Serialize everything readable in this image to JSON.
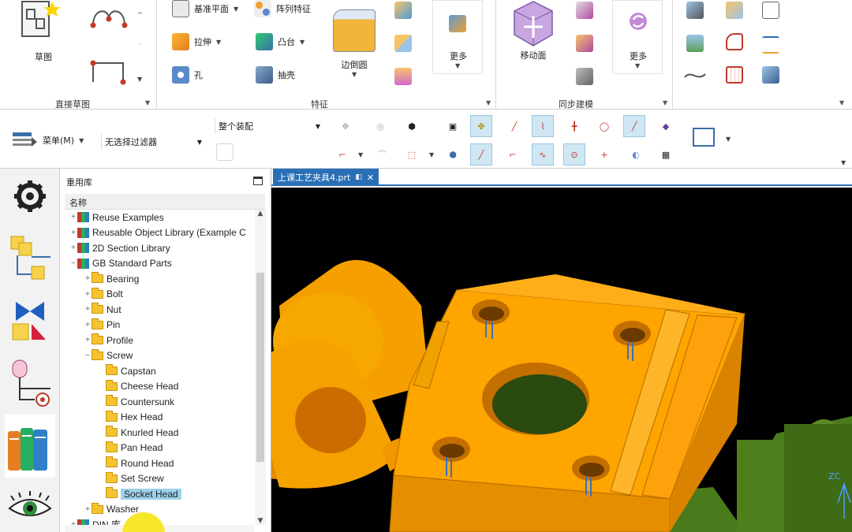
{
  "ribbon": {
    "groups": {
      "direct_sketch": "直接草图",
      "feature": "特征",
      "sync_modeling": "同步建模"
    },
    "sketch_label": "草图",
    "datum_plane_label": "基准平面",
    "pattern_feature_label": "阵列特征",
    "extrude_label": "拉伸",
    "boss_label": "凸台",
    "hole_label": "孔",
    "shell_label": "抽壳",
    "edge_blend_label": "边倒圆",
    "more_label": "更多",
    "move_face_label": "移动面",
    "more2_label": "更多"
  },
  "toolbar2": {
    "menu_label": "菜单(M)",
    "filter_label": "无选择过滤器",
    "scope_label": "整个装配"
  },
  "panel": {
    "title": "重用库",
    "column_header": "名称",
    "tree": [
      {
        "label": "Reuse Examples",
        "level": 0,
        "expander": "+",
        "icon": "library"
      },
      {
        "label": "Reusable Object Library (Example C",
        "level": 0,
        "expander": "+",
        "icon": "library"
      },
      {
        "label": "2D Section Library",
        "level": 0,
        "expander": "+",
        "icon": "library"
      },
      {
        "label": "GB Standard Parts",
        "level": 0,
        "expander": "−",
        "icon": "library"
      },
      {
        "label": "Bearing",
        "level": 1,
        "expander": "+",
        "icon": "folder"
      },
      {
        "label": "Bolt",
        "level": 1,
        "expander": "+",
        "icon": "folder"
      },
      {
        "label": "Nut",
        "level": 1,
        "expander": "+",
        "icon": "folder"
      },
      {
        "label": "Pin",
        "level": 1,
        "expander": "+",
        "icon": "folder"
      },
      {
        "label": "Profile",
        "level": 1,
        "expander": "+",
        "icon": "folder"
      },
      {
        "label": "Screw",
        "level": 1,
        "expander": "−",
        "icon": "folder"
      },
      {
        "label": "Capstan",
        "level": 2,
        "expander": "",
        "icon": "folder"
      },
      {
        "label": "Cheese Head",
        "level": 2,
        "expander": "",
        "icon": "folder"
      },
      {
        "label": "Countersunk",
        "level": 2,
        "expander": "",
        "icon": "folder"
      },
      {
        "label": "Hex Head",
        "level": 2,
        "expander": "",
        "icon": "folder"
      },
      {
        "label": "Knurled Head",
        "level": 2,
        "expander": "",
        "icon": "folder"
      },
      {
        "label": "Pan Head",
        "level": 2,
        "expander": "",
        "icon": "folder"
      },
      {
        "label": "Round Head",
        "level": 2,
        "expander": "",
        "icon": "folder"
      },
      {
        "label": "Set Screw",
        "level": 2,
        "expander": "",
        "icon": "folder"
      },
      {
        "label": "Socket Head",
        "level": 2,
        "expander": "",
        "icon": "folder",
        "selected": true
      },
      {
        "label": "Washer",
        "level": 1,
        "expander": "+",
        "icon": "folder"
      },
      {
        "label": "DIN 库",
        "level": 0,
        "expander": "+",
        "icon": "library"
      }
    ]
  },
  "graphics": {
    "tab_label": "上课工艺夹具4.prt",
    "tab_close": "✕",
    "axis_label": "ZC"
  },
  "colors": {
    "part_orange": "#ffa500",
    "part_green": "#4a7a1c",
    "tab_blue": "#2a6fb5",
    "selection_blue": "#9fd1ea"
  }
}
